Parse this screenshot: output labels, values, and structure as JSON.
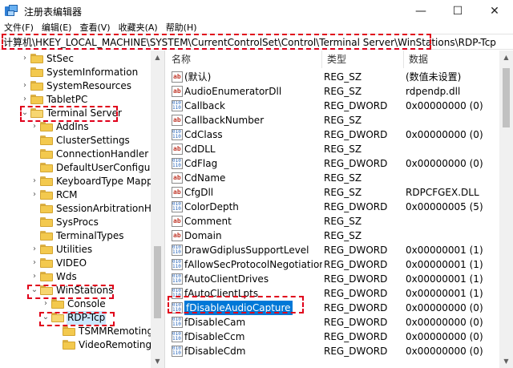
{
  "window": {
    "title": "注册表编辑器",
    "minimize": "—",
    "maximize": "☐",
    "close": "✕"
  },
  "menu": [
    "文件(F)",
    "编辑(E)",
    "查看(V)",
    "收藏夹(A)",
    "帮助(H)"
  ],
  "address": "计算机\\HKEY_LOCAL_MACHINE\\SYSTEM\\CurrentControlSet\\Control\\Terminal Server\\WinStations\\RDP-Tcp",
  "tree": [
    {
      "label": "StSec",
      "level": 2,
      "arrow": "›"
    },
    {
      "label": "SystemInformation",
      "level": 2,
      "arrow": ""
    },
    {
      "label": "SystemResources",
      "level": 2,
      "arrow": "›"
    },
    {
      "label": "TabletPC",
      "level": 2,
      "arrow": "›"
    },
    {
      "label": "Terminal Server",
      "level": 2,
      "arrow": "⌄",
      "open": true
    },
    {
      "label": "AddIns",
      "level": 3,
      "arrow": "›"
    },
    {
      "label": "ClusterSettings",
      "level": 3,
      "arrow": ""
    },
    {
      "label": "ConnectionHandler",
      "level": 3,
      "arrow": ""
    },
    {
      "label": "DefaultUserConfiguratio",
      "level": 3,
      "arrow": ""
    },
    {
      "label": "KeyboardType Mapping",
      "level": 3,
      "arrow": "›"
    },
    {
      "label": "RCM",
      "level": 3,
      "arrow": "›"
    },
    {
      "label": "SessionArbitrationHelpe",
      "level": 3,
      "arrow": ""
    },
    {
      "label": "SysProcs",
      "level": 3,
      "arrow": ""
    },
    {
      "label": "TerminalTypes",
      "level": 3,
      "arrow": ""
    },
    {
      "label": "Utilities",
      "level": 3,
      "arrow": "›"
    },
    {
      "label": "VIDEO",
      "level": 3,
      "arrow": "›"
    },
    {
      "label": "Wds",
      "level": 3,
      "arrow": "›"
    },
    {
      "label": "WinStations",
      "level": 3,
      "arrow": "⌄",
      "open": true
    },
    {
      "label": "Console",
      "level": 4,
      "arrow": "›"
    },
    {
      "label": "RDP-Tcp",
      "level": 4,
      "arrow": "⌄",
      "open": true,
      "selected": true
    },
    {
      "label": "TSMMRemotingAl",
      "level": 5,
      "arrow": ""
    },
    {
      "label": "VideoRemotingWi",
      "level": 5,
      "arrow": ""
    }
  ],
  "columns": {
    "name": "名称",
    "type": "类型",
    "data": "数据"
  },
  "values": [
    {
      "name": "(默认)",
      "type": "REG_SZ",
      "data": "(数值未设置)",
      "kind": "sz"
    },
    {
      "name": "AudioEnumeratorDll",
      "type": "REG_SZ",
      "data": "rdpendp.dll",
      "kind": "sz"
    },
    {
      "name": "Callback",
      "type": "REG_DWORD",
      "data": "0x00000000 (0)",
      "kind": "dw"
    },
    {
      "name": "CallbackNumber",
      "type": "REG_SZ",
      "data": "",
      "kind": "sz"
    },
    {
      "name": "CdClass",
      "type": "REG_DWORD",
      "data": "0x00000000 (0)",
      "kind": "dw"
    },
    {
      "name": "CdDLL",
      "type": "REG_SZ",
      "data": "",
      "kind": "sz"
    },
    {
      "name": "CdFlag",
      "type": "REG_DWORD",
      "data": "0x00000000 (0)",
      "kind": "dw"
    },
    {
      "name": "CdName",
      "type": "REG_SZ",
      "data": "",
      "kind": "sz"
    },
    {
      "name": "CfgDll",
      "type": "REG_SZ",
      "data": "RDPCFGEX.DLL",
      "kind": "sz"
    },
    {
      "name": "ColorDepth",
      "type": "REG_DWORD",
      "data": "0x00000005 (5)",
      "kind": "dw"
    },
    {
      "name": "Comment",
      "type": "REG_SZ",
      "data": "",
      "kind": "sz"
    },
    {
      "name": "Domain",
      "type": "REG_SZ",
      "data": "",
      "kind": "sz"
    },
    {
      "name": "DrawGdiplusSupportLevel",
      "type": "REG_DWORD",
      "data": "0x00000001 (1)",
      "kind": "dw"
    },
    {
      "name": "fAllowSecProtocolNegotiation",
      "type": "REG_DWORD",
      "data": "0x00000001 (1)",
      "kind": "dw"
    },
    {
      "name": "fAutoClientDrives",
      "type": "REG_DWORD",
      "data": "0x00000001 (1)",
      "kind": "dw"
    },
    {
      "name": "fAutoClientLpts",
      "type": "REG_DWORD",
      "data": "0x00000001 (1)",
      "kind": "dw"
    },
    {
      "name": "fDisableAudioCapture",
      "type": "REG_DWORD",
      "data": "0x00000000 (0)",
      "kind": "dw",
      "selected": true
    },
    {
      "name": "fDisableCam",
      "type": "REG_DWORD",
      "data": "0x00000000 (0)",
      "kind": "dw"
    },
    {
      "name": "fDisableCcm",
      "type": "REG_DWORD",
      "data": "0x00000000 (0)",
      "kind": "dw"
    },
    {
      "name": "fDisableCdm",
      "type": "REG_DWORD",
      "data": "0x00000000 (0)",
      "kind": "dw"
    }
  ]
}
